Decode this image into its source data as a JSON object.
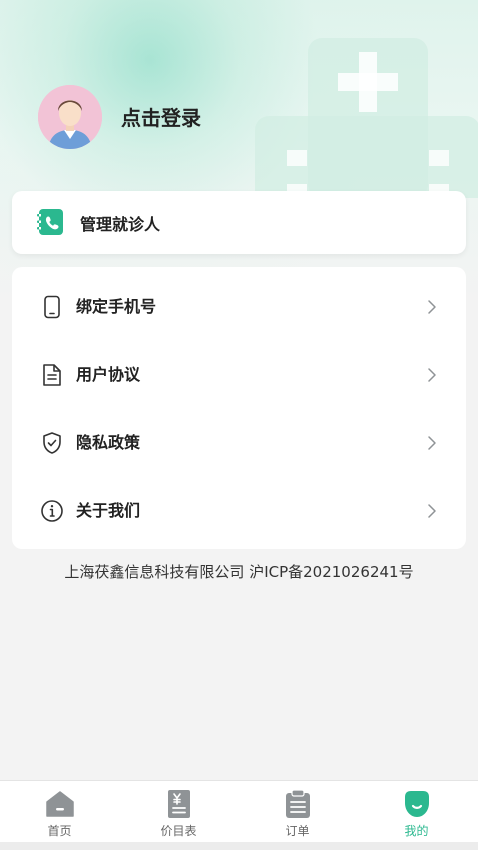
{
  "profile": {
    "login_text": "点击登录"
  },
  "patient_card": {
    "label": "管理就诊人"
  },
  "menu": {
    "items": [
      {
        "label": "绑定手机号",
        "icon": "phone-icon"
      },
      {
        "label": "用户协议",
        "icon": "document-icon"
      },
      {
        "label": "隐私政策",
        "icon": "shield-icon"
      },
      {
        "label": "关于我们",
        "icon": "info-icon"
      }
    ]
  },
  "footer": {
    "icp_text": "上海茯鑫信息科技有限公司 沪ICP备2021026241号"
  },
  "tabbar": {
    "tabs": [
      {
        "label": "首页",
        "icon": "home-icon",
        "active": false
      },
      {
        "label": "价目表",
        "icon": "price-list-icon",
        "active": false
      },
      {
        "label": "订单",
        "icon": "order-icon",
        "active": false
      },
      {
        "label": "我的",
        "icon": "profile-icon",
        "active": true
      }
    ]
  },
  "colors": {
    "accent": "#2bb88f",
    "inactive_tab": "#666666",
    "icon_gray": "#8f9396"
  }
}
